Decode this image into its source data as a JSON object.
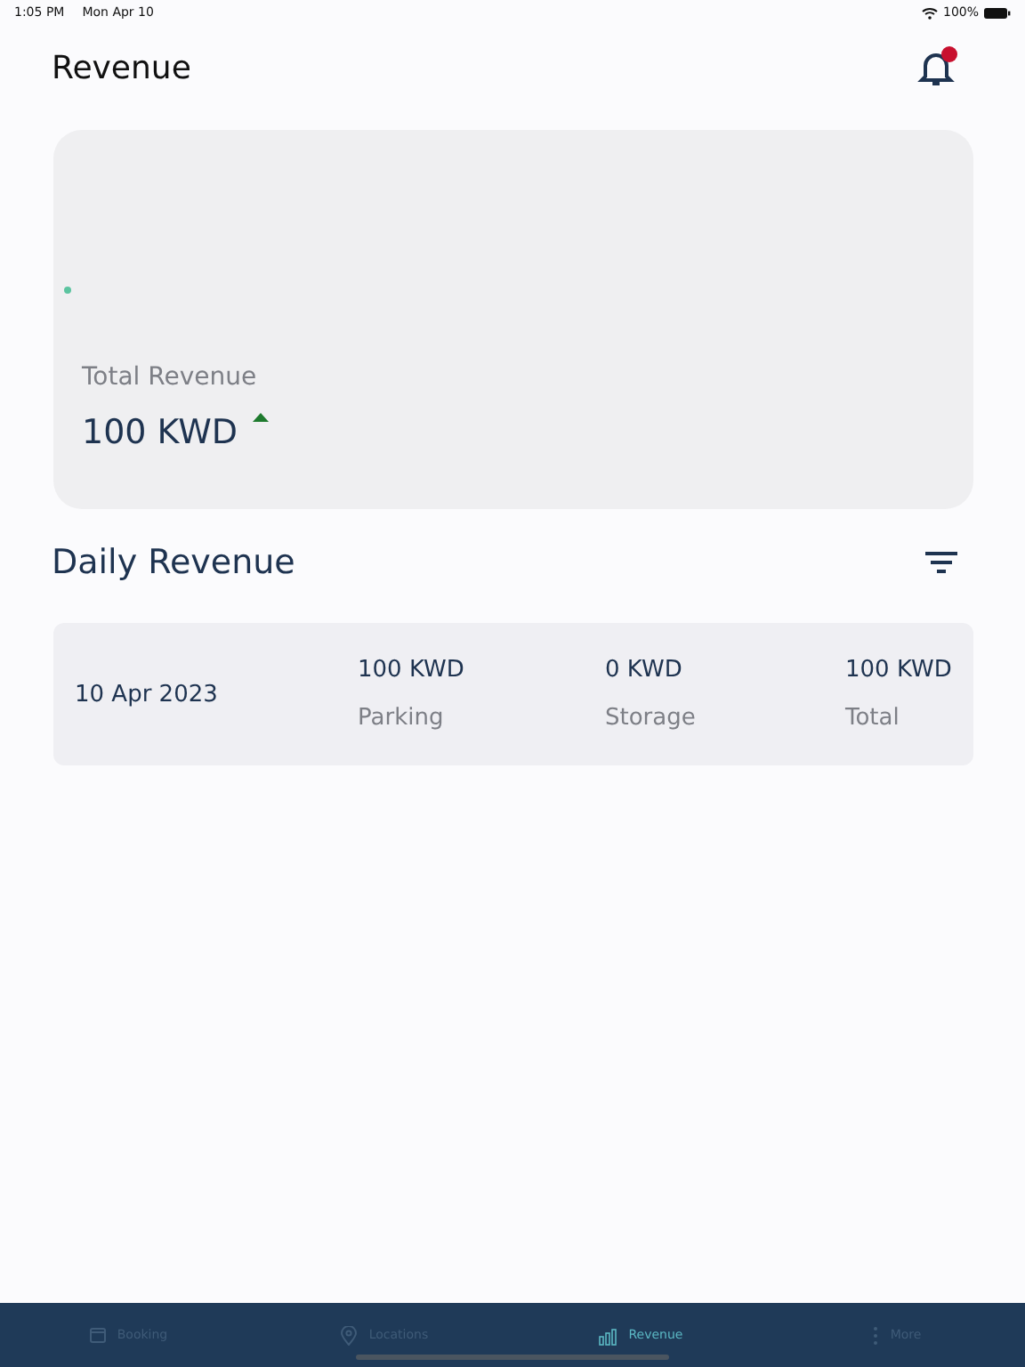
{
  "status_bar": {
    "time": "1:05 PM",
    "date": "Mon Apr 10",
    "battery": "100%"
  },
  "header": {
    "title": "Revenue",
    "notification_badge": true
  },
  "summary": {
    "label": "Total Revenue",
    "value": "100 KWD",
    "trend_up": true
  },
  "daily": {
    "title": "Daily Revenue",
    "rows": [
      {
        "date": "10 Apr 2023",
        "cells": [
          {
            "amount": "100 KWD",
            "label": "Parking"
          },
          {
            "amount": "0 KWD",
            "label": "Storage"
          },
          {
            "amount": "100 KWD",
            "label": "Total"
          }
        ]
      }
    ]
  },
  "tab_bar": [
    {
      "label": "Booking",
      "selected": false
    },
    {
      "label": "Locations",
      "selected": false
    },
    {
      "label": "Revenue",
      "selected": true
    },
    {
      "label": "More",
      "selected": false
    }
  ]
}
